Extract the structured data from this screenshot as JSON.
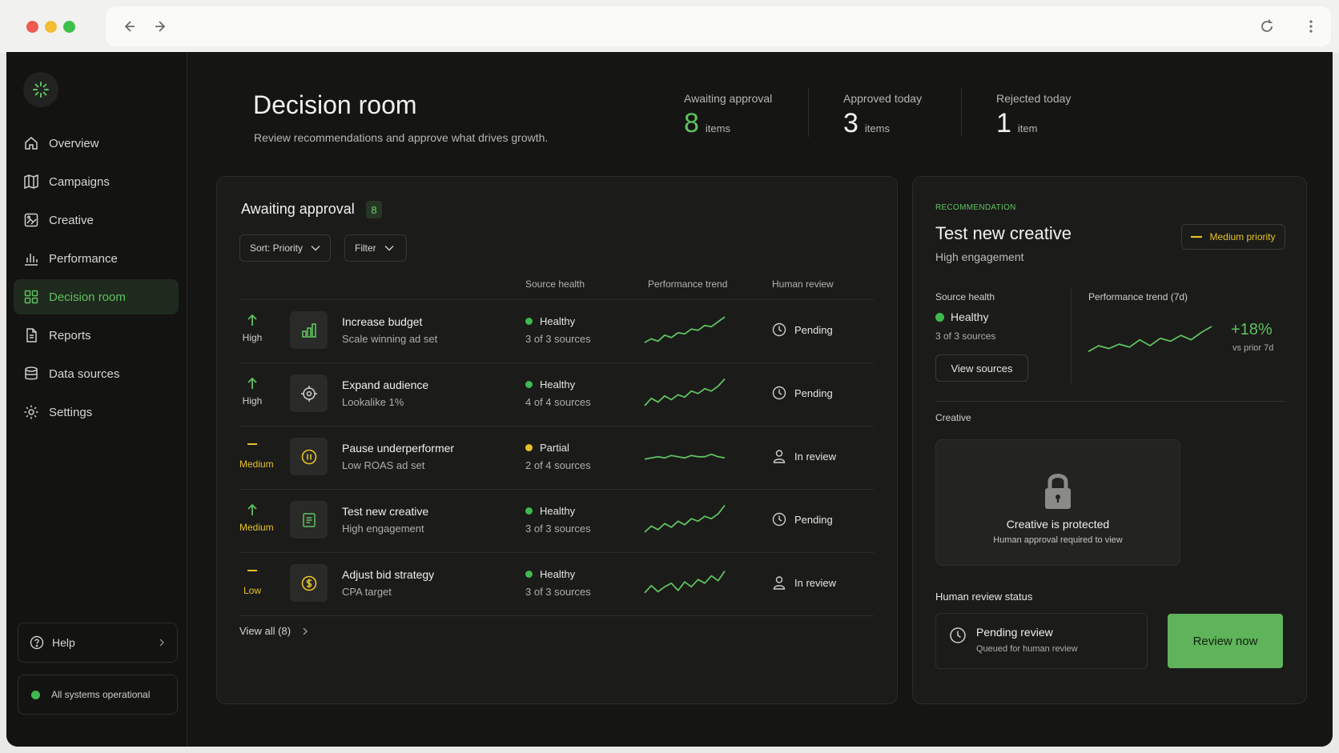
{
  "sidebar": {
    "items": [
      {
        "label": "Overview",
        "icon": "home-icon"
      },
      {
        "label": "Campaigns",
        "icon": "map-icon"
      },
      {
        "label": "Creative",
        "icon": "image-edit-icon"
      },
      {
        "label": "Performance",
        "icon": "bar-chart-icon"
      },
      {
        "label": "Decision room",
        "icon": "grid-icon",
        "active": true
      },
      {
        "label": "Reports",
        "icon": "document-icon"
      },
      {
        "label": "Data sources",
        "icon": "database-icon"
      },
      {
        "label": "Settings",
        "icon": "gear-icon"
      }
    ],
    "help_label": "Help",
    "status_label": "All systems operational"
  },
  "header": {
    "title": "Decision room",
    "subtitle": "Review recommendations and approve what drives growth.",
    "stats": [
      {
        "label": "Awaiting approval",
        "value": "8",
        "unit": "items",
        "color": "#5fc25f"
      },
      {
        "label": "Approved today",
        "value": "3",
        "unit": "items",
        "color": "#f2f2f0"
      },
      {
        "label": "Rejected today",
        "value": "1",
        "unit": "item",
        "color": "#f2f2f0"
      }
    ]
  },
  "queue": {
    "title": "Awaiting approval",
    "count": "8",
    "sort_label": "Sort: Priority",
    "filter_label": "Filter",
    "columns": {
      "health": "Source health",
      "trend": "Performance trend",
      "review": "Human review"
    },
    "rows": [
      {
        "priority": "High",
        "priority_icon": "arrow-up-icon",
        "icon": "bar-chart-icon",
        "title": "Increase budget",
        "sub": "Scale winning ad set",
        "health": "Healthy",
        "sources": "3 of 3 sources",
        "review": "Pending",
        "review_icon": "clock-icon",
        "trend": [
          2,
          5,
          3,
          8,
          6,
          10,
          9,
          13,
          12,
          16,
          15,
          19,
          23
        ]
      },
      {
        "priority": "High",
        "priority_icon": "arrow-up-icon",
        "icon": "target-icon",
        "title": "Expand audience",
        "sub": "Lookalike 1%",
        "health": "Healthy",
        "sources": "4 of 4 sources",
        "review": "Pending",
        "review_icon": "clock-icon",
        "trend": [
          2,
          8,
          5,
          10,
          7,
          11,
          9,
          14,
          12,
          16,
          14,
          18,
          24
        ]
      },
      {
        "priority": "Medium",
        "priority_icon": "dash-icon",
        "icon": "pause-icon",
        "title": "Pause underperformer",
        "sub": "Low ROAS ad set",
        "health": "Partial",
        "sources": "2 of 4 sources",
        "review": "In review",
        "review_icon": "person-icon",
        "trend": [
          10,
          11,
          12,
          11,
          13,
          12,
          11,
          13,
          12,
          12,
          14,
          12,
          11
        ]
      },
      {
        "priority": "Medium",
        "priority_icon": "arrow-up-icon",
        "icon": "document-icon",
        "title": "Test new creative",
        "sub": "High engagement",
        "health": "Healthy",
        "sources": "3 of 3 sources",
        "review": "Pending",
        "review_icon": "clock-icon",
        "trend": [
          2,
          7,
          4,
          9,
          6,
          11,
          8,
          13,
          11,
          15,
          13,
          17,
          24
        ]
      },
      {
        "priority": "Low",
        "priority_icon": "dash-icon",
        "icon": "dollar-icon",
        "title": "Adjust bid strategy",
        "sub": "CPA target",
        "health": "Healthy",
        "sources": "3 of 3 sources",
        "review": "In review",
        "review_icon": "person-icon",
        "trend": [
          4,
          10,
          5,
          9,
          12,
          6,
          13,
          9,
          15,
          12,
          18,
          14,
          22
        ]
      }
    ],
    "view_all": "View all (8)"
  },
  "detail": {
    "eyebrow": "RECOMMENDATION",
    "title": "Test new creative",
    "subtitle": "High engagement",
    "priority_badge": "Medium priority",
    "source_health_label": "Source health",
    "health": "Healthy",
    "sources": "3 of 3 sources",
    "view_sources": "View sources",
    "trend_label": "Performance trend (7d)",
    "trend_change": "+18%",
    "trend_compare": "vs prior 7d",
    "trend": [
      2,
      6,
      4,
      7,
      5,
      10,
      6,
      11,
      9,
      13,
      10,
      15,
      19
    ],
    "creative_label": "Creative",
    "creative_locked_title": "Creative is protected",
    "creative_locked_sub": "Human approval required to view",
    "review_status_label": "Human review status",
    "review_status": "Pending review",
    "review_status_sub": "Queued for human review",
    "review_button": "Review now"
  },
  "colors": {
    "accent": "#5fc25f",
    "warning": "#e6c229",
    "background": "#151514"
  }
}
